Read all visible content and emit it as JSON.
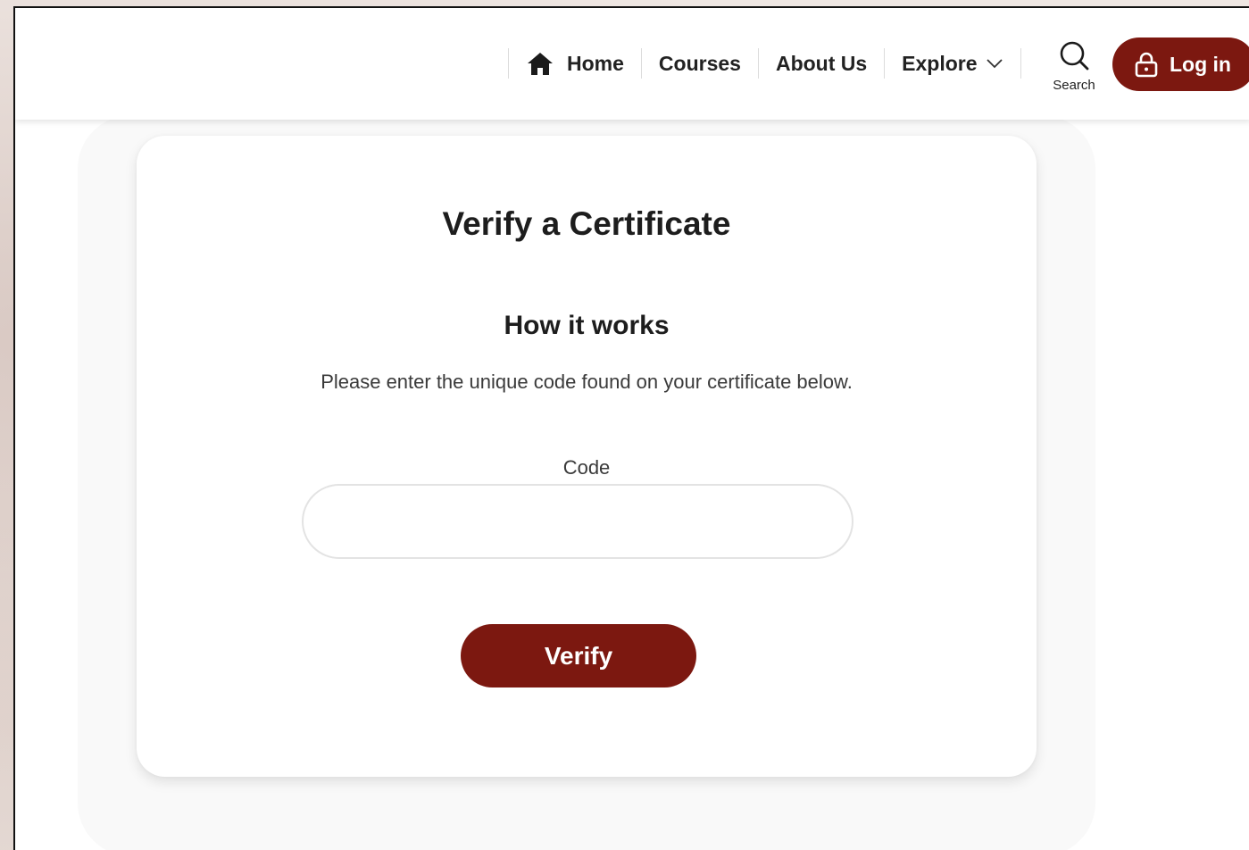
{
  "header": {
    "nav": [
      {
        "label": "Home",
        "icon": "home-icon"
      },
      {
        "label": "Courses"
      },
      {
        "label": "About Us"
      },
      {
        "label": "Explore",
        "icon": "chevron-down-icon"
      }
    ],
    "search_label": "Search",
    "login_label": "Log in"
  },
  "card": {
    "title": "Verify a Certificate",
    "subtitle": "How it works",
    "description": "Please enter the unique code found on your certificate below.",
    "code_label": "Code",
    "code_value": "",
    "verify_label": "Verify"
  },
  "colors": {
    "accent": "#7c1810",
    "text": "#222222",
    "muted_text": "#3a3a3a",
    "border": "#e3e3e3"
  }
}
